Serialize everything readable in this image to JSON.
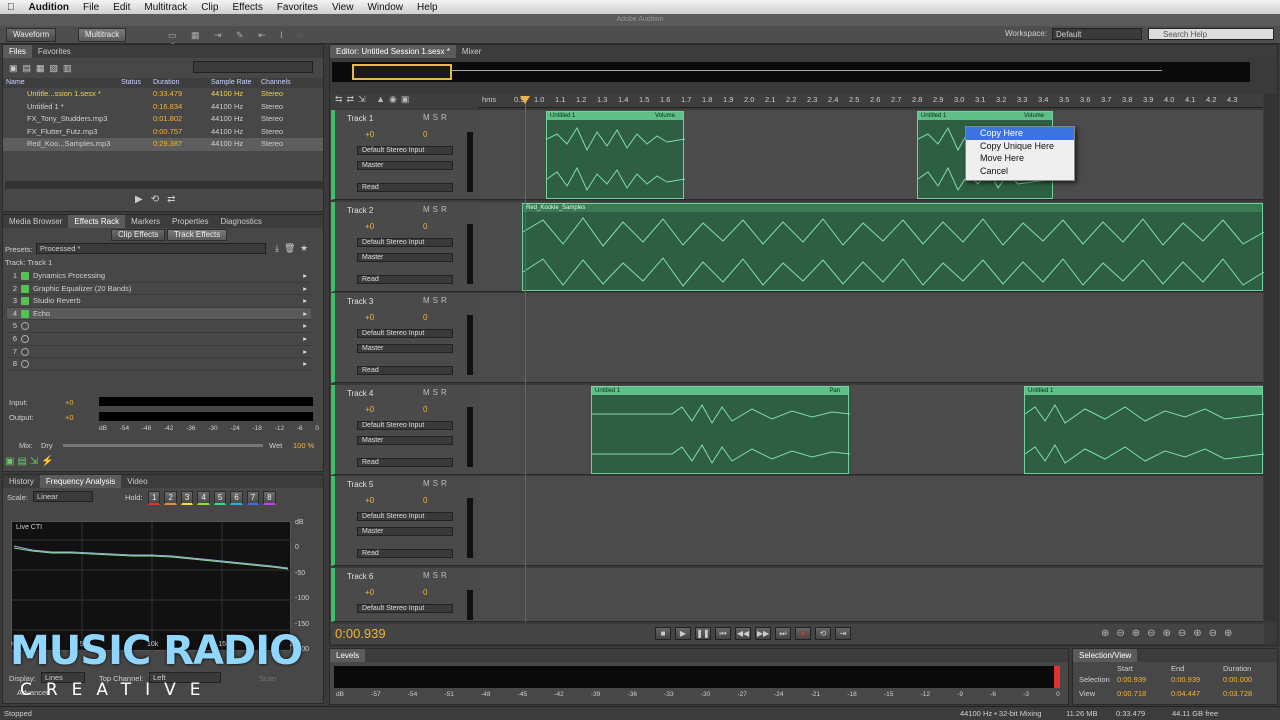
{
  "menubar": {
    "app": "Audition",
    "items": [
      "File",
      "Edit",
      "Multitrack",
      "Clip",
      "Effects",
      "Favorites",
      "View",
      "Window",
      "Help"
    ]
  },
  "window_title": "Adobe Audition",
  "toolbar": {
    "waveform": "Waveform",
    "multitrack": "Multitrack",
    "workspace_label": "Workspace:",
    "workspace_value": "Default",
    "search_placeholder": "Search Help"
  },
  "files_panel": {
    "tabs": [
      "Files",
      "Favorites"
    ],
    "headers": [
      "Name",
      "Status",
      "Duration",
      "Sample Rate",
      "Channels"
    ],
    "rows": [
      {
        "name": "Untitle...ssion 1.sesx *",
        "duration": "0:33.479",
        "rate": "44100 Hz",
        "ch": "Stereo"
      },
      {
        "name": "Untitled 1 *",
        "duration": "0:16.834",
        "rate": "44100 Hz",
        "ch": "Stereo"
      },
      {
        "name": "FX_Tony_Studders.mp3",
        "duration": "0:01.802",
        "rate": "44100 Hz",
        "ch": "Stereo"
      },
      {
        "name": "FX_Flutter_Futz.mp3",
        "duration": "0:00.757",
        "rate": "44100 Hz",
        "ch": "Stereo"
      },
      {
        "name": "Red_Koo...Samples.mp3",
        "duration": "0:29.387",
        "rate": "44100 Hz",
        "ch": "Stereo"
      }
    ]
  },
  "effects_panel": {
    "tabs": [
      "Media Browser",
      "Effects Rack",
      "Markers",
      "Properties",
      "Diagnostics"
    ],
    "subtabs": [
      "Clip Effects",
      "Track Effects"
    ],
    "presets_label": "Presets:",
    "presets_value": "Processed *",
    "track_label": "Track: Track 1",
    "effects": [
      {
        "n": "1",
        "name": "Dynamics Processing"
      },
      {
        "n": "2",
        "name": "Graphic Equalizer (20 Bands)"
      },
      {
        "n": "3",
        "name": "Studio Reverb"
      },
      {
        "n": "4",
        "name": "Echo"
      },
      {
        "n": "5",
        "name": ""
      },
      {
        "n": "6",
        "name": ""
      },
      {
        "n": "7",
        "name": ""
      },
      {
        "n": "8",
        "name": ""
      }
    ],
    "input_label": "Input:",
    "output_label": "Output:",
    "gain": "+0",
    "mix_label": "Mix:",
    "dry": "Dry",
    "wet": "Wet",
    "wet_pct": "100 %",
    "meter_ticks": [
      "dB",
      "-54",
      "-48",
      "-42",
      "-36",
      "-30",
      "-24",
      "-18",
      "-12",
      "-6",
      "0"
    ]
  },
  "freq_panel": {
    "tabs": [
      "History",
      "Frequency Analysis",
      "Video"
    ],
    "scale_label": "Scale:",
    "scale_value": "Linear",
    "hold_label": "Hold:",
    "holds": [
      "1",
      "2",
      "3",
      "4",
      "5",
      "6",
      "7",
      "8"
    ],
    "live": "Live CTI",
    "db_ticks": [
      "dB",
      "0",
      "-50",
      "-100",
      "-150",
      "-200"
    ],
    "hz": "Hz",
    "khz": [
      "5k",
      "10k",
      "15k",
      "20k"
    ],
    "display_label": "Display:",
    "display_value": "Lines",
    "topch_label": "Top Channel:",
    "topch_value": "Left",
    "scan": "Scan",
    "advanced": "Advanced"
  },
  "editor": {
    "tabs": [
      "Editor: Untitled Session 1.sesx *",
      "Mixer"
    ],
    "ruler_unit": "hms",
    "ruler": [
      "0.9",
      "1.0",
      "1.1",
      "1.2",
      "1.3",
      "1.4",
      "1.5",
      "1.6",
      "1.7",
      "1.8",
      "1.9",
      "2.0",
      "2.1",
      "2.2",
      "2.3",
      "2.4",
      "2.5",
      "2.6",
      "2.7",
      "2.8",
      "2.9",
      "3.0",
      "3.1",
      "3.2",
      "3.3",
      "3.4",
      "3.5",
      "3.6",
      "3.7",
      "3.8",
      "3.9",
      "4.0",
      "4.1",
      "4.2",
      "4.3"
    ],
    "time": "0:00.939"
  },
  "tracks": [
    {
      "name": "Track 1",
      "vol": "+0",
      "pan": "0",
      "input": "Default Stereo Input",
      "output": "Master",
      "mode": "Read"
    },
    {
      "name": "Track 2",
      "vol": "+0",
      "pan": "0",
      "input": "Default Stereo Input",
      "output": "Master",
      "mode": "Read"
    },
    {
      "name": "Track 3",
      "vol": "+0",
      "pan": "0",
      "input": "Default Stereo Input",
      "output": "Master",
      "mode": "Read"
    },
    {
      "name": "Track 4",
      "vol": "+0",
      "pan": "0",
      "input": "Default Stereo Input",
      "output": "Master",
      "mode": "Read"
    },
    {
      "name": "Track 5",
      "vol": "+0",
      "pan": "0",
      "input": "Default Stereo Input",
      "output": "Master",
      "mode": "Read"
    },
    {
      "name": "Track 6",
      "vol": "+0",
      "pan": "0",
      "input": "Default Stereo Input",
      "output": ""
    }
  ],
  "clips": {
    "t1a": "Untitled 1",
    "t1a_env": "Volume",
    "t1b": "Untitled 1",
    "t1b_env": "Volume",
    "t2": "Red_Kookie_Samples",
    "t4a": "Untitled 1",
    "t4a_env": "Pan",
    "t4b": "Untitled 1"
  },
  "context_menu": [
    "Copy Here",
    "Copy Unique Here",
    "Move Here",
    "Cancel"
  ],
  "levels": {
    "title": "Levels",
    "ticks": [
      "dB",
      "-57",
      "-54",
      "-51",
      "-48",
      "-45",
      "-42",
      "-39",
      "-36",
      "-33",
      "-30",
      "-27",
      "-24",
      "-21",
      "-18",
      "-15",
      "-12",
      "-9",
      "-6",
      "-3",
      "0"
    ]
  },
  "selview": {
    "title": "Selection/View",
    "cols": [
      "Start",
      "End",
      "Duration"
    ],
    "sel_label": "Selection",
    "view_label": "View",
    "sel": [
      "0:00.939",
      "0:00.939",
      "0:00.000"
    ],
    "view": [
      "0:00.718",
      "0:04.447",
      "0:03.728"
    ]
  },
  "status": {
    "left": "Stopped",
    "rate": "44100 Hz • 32-bit Mixing",
    "size": "11.26 MB",
    "dur": "0:33.479",
    "free": "44.11 GB free"
  },
  "watermark": {
    "line1": "MUSIC RADIO",
    "line2": "CREATIVE"
  }
}
